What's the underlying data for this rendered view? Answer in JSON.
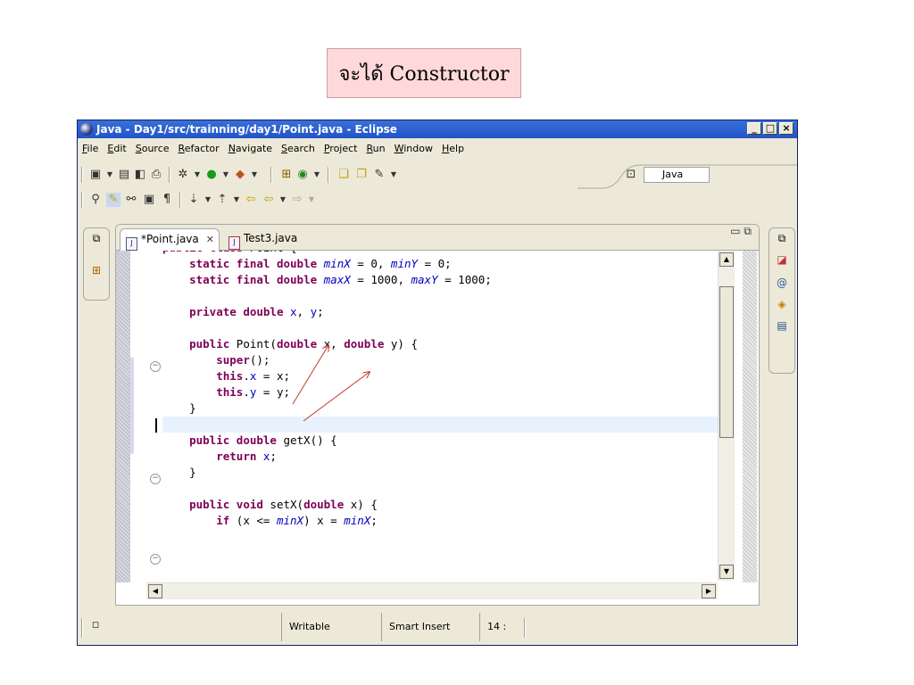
{
  "caption": "จะได้ Constructor",
  "window": {
    "title": "Java - Day1/src/trainning/day1/Point.java - Eclipse",
    "controls": [
      "_",
      "□",
      "×"
    ]
  },
  "menu": [
    "File",
    "Edit",
    "Source",
    "Refactor",
    "Navigate",
    "Search",
    "Project",
    "Run",
    "Window",
    "Help"
  ],
  "perspective": {
    "label": "Java"
  },
  "tabs": [
    {
      "label": "*Point.java",
      "close": "✕"
    },
    {
      "label": "Test3.java"
    }
  ],
  "code": {
    "lines": [
      "public class Point {",
      "    static final double minX = 0, minY = 0;",
      "    static final double maxX = 1000, maxY = 1000;",
      "",
      "    private double x, y;",
      "",
      "    public Point(double x, double y) {",
      "        super();",
      "        this.x = x;",
      "        this.y = y;",
      "    }",
      "",
      "    public double getX() {",
      "        return x;",
      "    }",
      "",
      "    public void setX(double x) {",
      "        if (x <= minX) x = minX;"
    ]
  },
  "status": {
    "writable": "Writable",
    "insert_mode": "Smart Insert",
    "position": "14 :"
  }
}
